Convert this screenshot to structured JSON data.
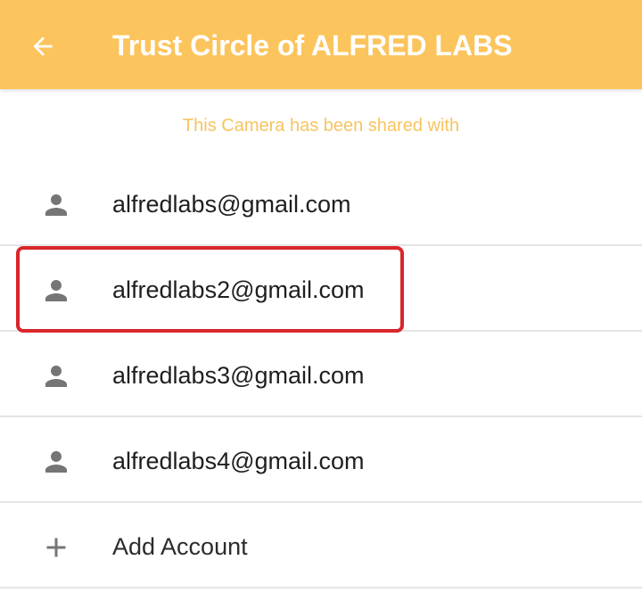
{
  "header": {
    "title": "Trust Circle of ALFRED LABS",
    "back_icon": "arrow-left-icon",
    "background": "#FCC45C"
  },
  "subtitle": "This Camera has been shared with",
  "accounts": [
    {
      "email": "alfredlabs@gmail.com",
      "icon": "person-icon",
      "highlighted": false
    },
    {
      "email": "alfredlabs2@gmail.com",
      "icon": "person-icon",
      "highlighted": true
    },
    {
      "email": "alfredlabs3@gmail.com",
      "icon": "person-icon",
      "highlighted": false
    },
    {
      "email": "alfredlabs4@gmail.com",
      "icon": "person-icon",
      "highlighted": false
    }
  ],
  "add_account": {
    "label": "Add Account",
    "icon": "plus-icon"
  },
  "colors": {
    "accent": "#FCC45C",
    "subtitle": "#F7C45F",
    "highlight": "#D9262B",
    "icon": "#757575"
  }
}
